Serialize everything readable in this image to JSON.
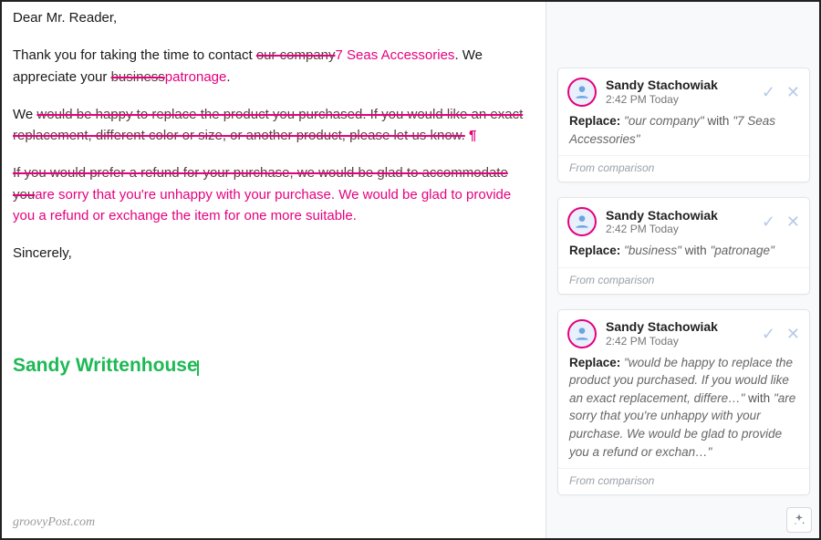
{
  "document": {
    "greeting": "Dear Mr. Reader,",
    "p1_pre": "Thank you for taking the time to contact ",
    "p1_del1": "our company",
    "p1_ins1": "7 Seas Accessories",
    "p1_mid": ". We appreciate your ",
    "p1_del2": "business",
    "p1_ins2": "patronage",
    "p1_post": ".",
    "p2_pre": "We ",
    "p2_del": "would be happy to replace the product you purchased. If you would like an exact replacement, different color or size, or another product, please let us know.",
    "p2_pilcrow": " ¶",
    "p3_del": "If you would prefer a refund for your purchase, we would be glad to accommodate you",
    "p3_ins": "are sorry that you're unhappy with your purchase. We would be glad to provide you a refund or exchange the item for one more suitable",
    "p3_post": ".",
    "closing": "Sincerely,",
    "signature": "Sandy Writtenhouse"
  },
  "watermark": "groovyPost.com",
  "labels": {
    "replace": "Replace:",
    "with": "with",
    "from_comparison": "From comparison"
  },
  "comments": [
    {
      "author": "Sandy Stachowiak",
      "time": "2:42 PM Today",
      "old": "\"our company\"",
      "new": "\"7 Seas Accessories\""
    },
    {
      "author": "Sandy Stachowiak",
      "time": "2:42 PM Today",
      "old": "\"business\"",
      "new": "\"patronage\""
    },
    {
      "author": "Sandy Stachowiak",
      "time": "2:42 PM Today",
      "old": "\"would be happy to replace the product you purchased. If you would like an exact replacement, differe…\"",
      "new": "\"are sorry that you're unhappy with your purchase. We would be glad to provide you a refund or exchan…\""
    }
  ]
}
